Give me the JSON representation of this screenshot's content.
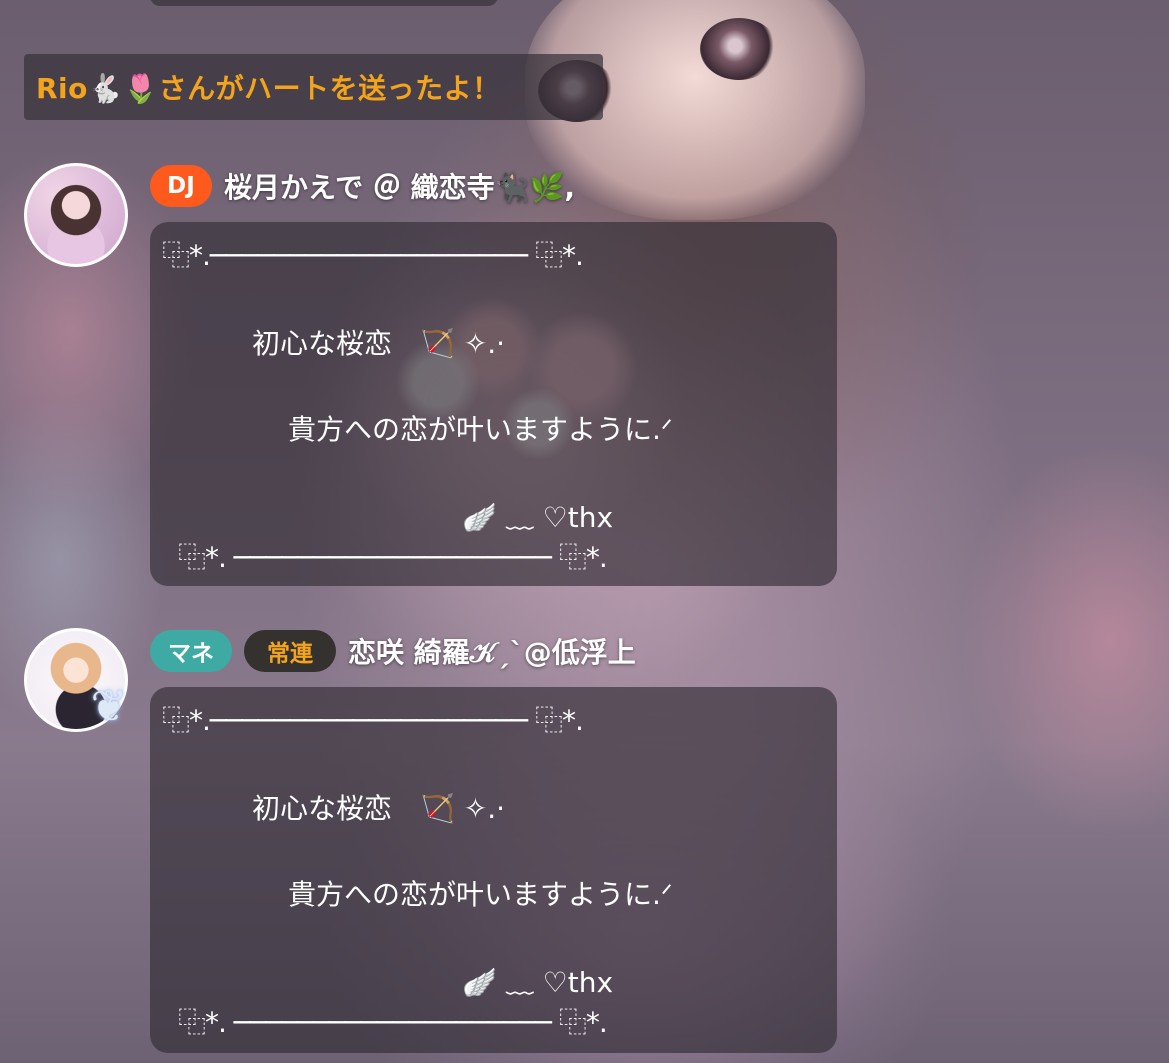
{
  "gift_notice": {
    "text": "Rio🐇🌷さんがハートを送ったよ！"
  },
  "messages": [
    {
      "badges": [
        "DJ"
      ],
      "username": "桜月かえで ＠ 織恋寺🐈‍⬛🌿,",
      "lines": {
        "top": "⿻*.──────────────────── ⿻*.",
        "l1": "初心な桜恋　🏹 ✧.·",
        "l2": "貴方への恋が叶いますように.ᐟ",
        "l3": "🪽 ﹏ ♡thx",
        "bottom": "⿻*. ──────────────────── ⿻*."
      }
    },
    {
      "badges": [
        "マネ",
        "常連"
      ],
      "username": "恋咲 綺羅𝒦ˏˋ@低浮上",
      "lines": {
        "top": "⿻*.──────────────────── ⿻*.",
        "l1": "初心な桜恋　🏹 ✧.·",
        "l2": "貴方への恋が叶いますように.ᐟ",
        "l3": "🪽 ﹏ ♡thx",
        "bottom": "⿻*. ──────────────────── ⿻*."
      }
    }
  ],
  "colors": {
    "gift_text": "#f3a41c",
    "badge_dj": "#ff5a1e",
    "badge_mane": "#3eaaa3",
    "badge_joren_bg": "#34312f",
    "badge_joren_text": "#f3a41c",
    "bubble_bg": "rgba(48,44,52,0.64)"
  },
  "icons": {
    "avatar_deco": "angel-wing-icon"
  }
}
